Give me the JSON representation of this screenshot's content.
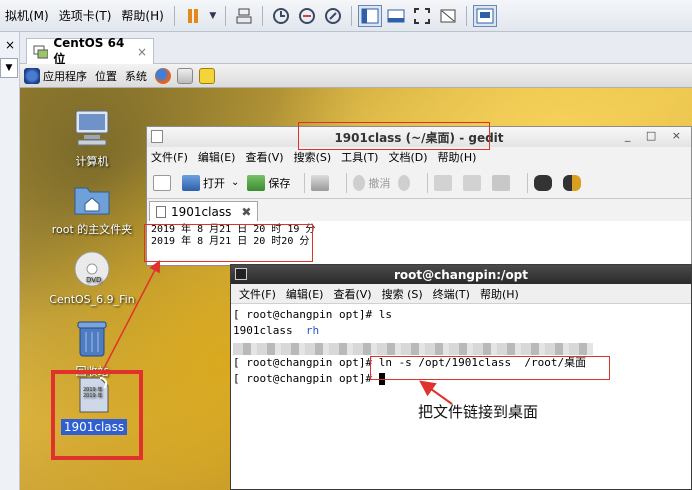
{
  "vmware": {
    "menu": [
      "拟机(M)",
      "选项卡(T)",
      "帮助(H)"
    ],
    "tab_label": "CentOS 64 位",
    "tab_close": "×",
    "left_close": "×"
  },
  "panel": {
    "apps": "应用程序",
    "places": "位置",
    "system": "系统"
  },
  "desktop_icons": [
    {
      "label": "计算机",
      "icon": "computer-icon"
    },
    {
      "label": "root 的主文件夹",
      "icon": "home-folder-icon"
    },
    {
      "label": "CentOS_6.9_Fin",
      "icon": "dvd-icon"
    },
    {
      "label": "回收站",
      "icon": "trash-icon"
    },
    {
      "label": "1901class",
      "icon": "file-link-icon"
    }
  ],
  "gedit": {
    "title": "1901class (~/桌面) - gedit",
    "window_controls": "_ □ ×",
    "menu": [
      "文件(F)",
      "编辑(E)",
      "查看(V)",
      "搜索(S)",
      "工具(T)",
      "文档(D)",
      "帮助(H)"
    ],
    "toolbar": {
      "open": "打开",
      "save": "保存",
      "undo": "撤消"
    },
    "tab": "1901class",
    "tab_close": "✖",
    "lines": [
      "2019 年 8 月21  日 20 时 19 分",
      "2019 年 8 月21  日 20 时20 分"
    ]
  },
  "terminal": {
    "title": "root@changpin:/opt",
    "menu": [
      "文件(F)",
      "编辑(E)",
      "查看(V)",
      "搜索 (S)",
      "终端(T)",
      "帮助(H)"
    ],
    "line1": "[ root@changpin opt]# ls",
    "line2_a": "1901class  ",
    "line2_b": "rh",
    "line4": "[ root@changpin opt]# ln -s /opt/1901class  /root/桌面",
    "line5": "[ root@changpin opt]# "
  },
  "annotation": "把文件链接到桌面",
  "colors": {
    "annotation_red": "#e0322d",
    "terminal_blue": "#2a56c6"
  }
}
